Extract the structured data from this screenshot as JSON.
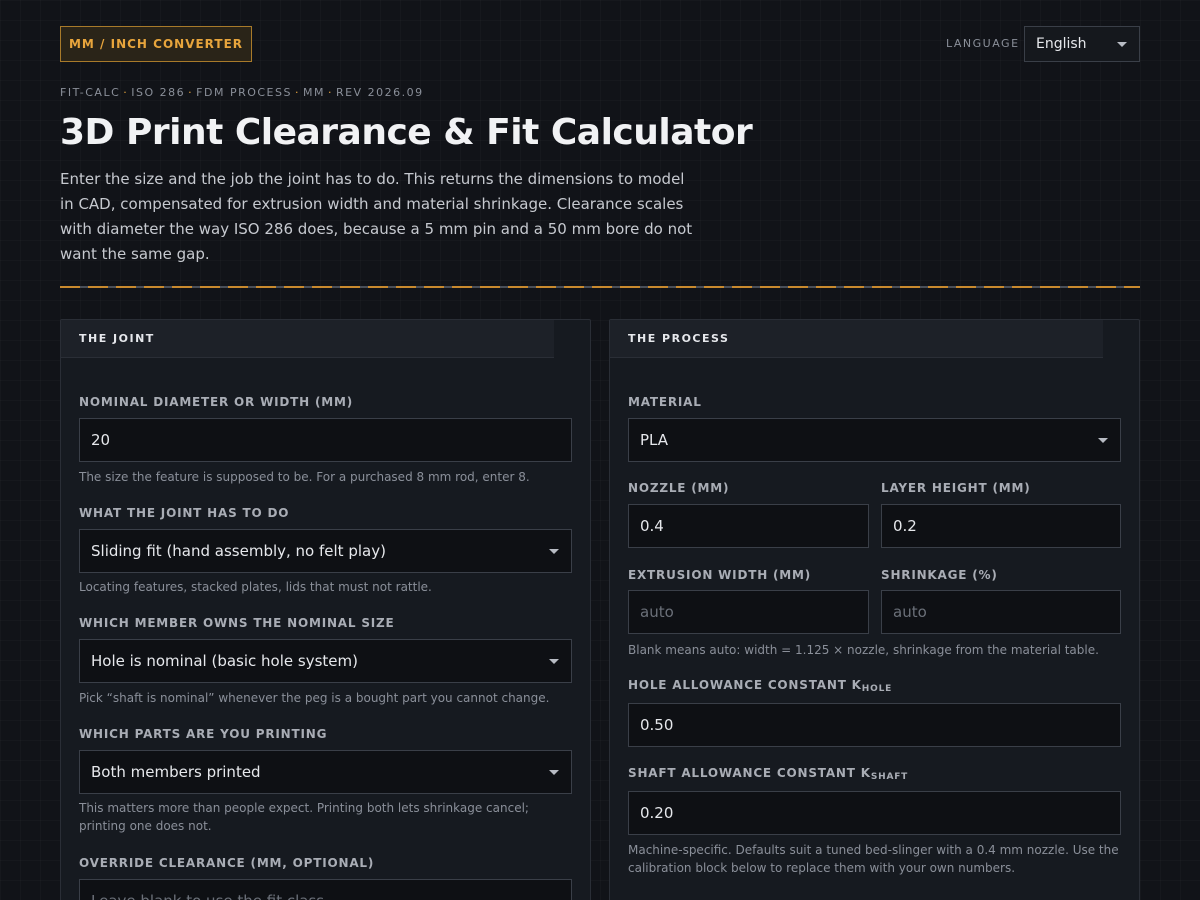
{
  "header": {
    "converter_label": "MM / INCH CONVERTER",
    "language_label": "LANGUAGE",
    "language_value": "English"
  },
  "meta": {
    "items": [
      "FIT-CALC",
      "ISO 286",
      "FDM PROCESS",
      "MM",
      "REV 2026.09"
    ]
  },
  "title": "3D Print Clearance & Fit Calculator",
  "intro": "Enter the size and the job the joint has to do. This returns the dimensions to model in CAD, compensated for extrusion width and material shrinkage. Clearance scales with diameter the way ISO 286 does, because a 5 mm pin and a 50 mm bore do not want the same gap.",
  "joint": {
    "heading": "THE JOINT",
    "nominal_label": "NOMINAL DIAMETER OR WIDTH (MM)",
    "nominal_value": "20",
    "nominal_hint": "The size the feature is supposed to be. For a purchased 8 mm rod, enter 8.",
    "job_label": "WHAT THE JOINT HAS TO DO",
    "job_value": "Sliding fit (hand assembly, no felt play)",
    "job_hint": "Locating features, stacked plates, lids that must not rattle.",
    "member_label": "WHICH MEMBER OWNS THE NOMINAL SIZE",
    "member_value": "Hole is nominal (basic hole system)",
    "member_hint": "Pick “shaft is nominal” whenever the peg is a bought part you cannot change.",
    "parts_label": "WHICH PARTS ARE YOU PRINTING",
    "parts_value": "Both members printed",
    "parts_hint": "This matters more than people expect. Printing both lets shrinkage cancel; printing one does not.",
    "override_label": "OVERRIDE CLEARANCE (MM, OPTIONAL)",
    "override_placeholder": "Leave blank to use the fit class"
  },
  "process": {
    "heading": "THE PROCESS",
    "material_label": "MATERIAL",
    "material_value": "PLA",
    "nozzle_label": "NOZZLE (MM)",
    "nozzle_value": "0.4",
    "layer_label": "LAYER HEIGHT (MM)",
    "layer_value": "0.2",
    "extrusion_label": "EXTRUSION WIDTH (MM)",
    "extrusion_placeholder": "auto",
    "shrink_label": "SHRINKAGE (%)",
    "shrink_placeholder": "auto",
    "auto_hint": "Blank means auto: width = 1.125 × nozzle, shrinkage from the material table.",
    "hole_k_label": "HOLE ALLOWANCE CONSTANT K",
    "hole_k_sub": "HOLE",
    "hole_k_value": "0.50",
    "shaft_k_label": "SHAFT ALLOWANCE CONSTANT K",
    "shaft_k_sub": "SHAFT",
    "shaft_k_value": "0.20",
    "machine_hint": "Machine-specific. Defaults suit a tuned bed-slinger with a 0.4 mm nozzle. Use the calibration block below to replace them with your own numbers."
  },
  "colors": {
    "accent": "#e8a53c",
    "background": "#111318",
    "panel": "#161a20"
  }
}
